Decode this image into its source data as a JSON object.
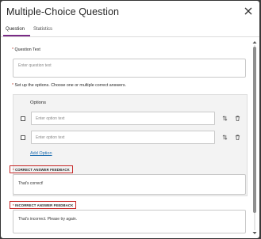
{
  "dialog": {
    "title": "Multiple-Choice Question"
  },
  "tabs": [
    {
      "label": "Question",
      "active": true
    },
    {
      "label": "Statistics",
      "active": false
    }
  ],
  "question_text": {
    "label": "Question Text",
    "required_marker": "*",
    "placeholder": "Enter question text"
  },
  "options_section": {
    "instruction": "Set up the options. Choose one or multiple correct answers.",
    "required_marker": "*",
    "header": "Options",
    "options": [
      {
        "placeholder": "Enter option text",
        "checked": false
      },
      {
        "placeholder": "Enter option text",
        "checked": false
      }
    ],
    "add_option_label": "Add Option"
  },
  "correct_feedback": {
    "label": "CORRECT ANSWER FEEDBACK",
    "required_marker": "*",
    "value": "That's correct!"
  },
  "incorrect_feedback": {
    "label": "INCORRECT ANSWER FEEDBACK",
    "required_marker": "*",
    "value": "That's incorrect. Please try again."
  },
  "colors": {
    "accent": "#7a2b86",
    "link": "#1f6fb0",
    "required": "#c0392b",
    "highlight_box": "#c62828"
  },
  "icons": {
    "close": "close-icon",
    "reorder": "reorder-arrows-icon",
    "delete": "trash-icon"
  }
}
